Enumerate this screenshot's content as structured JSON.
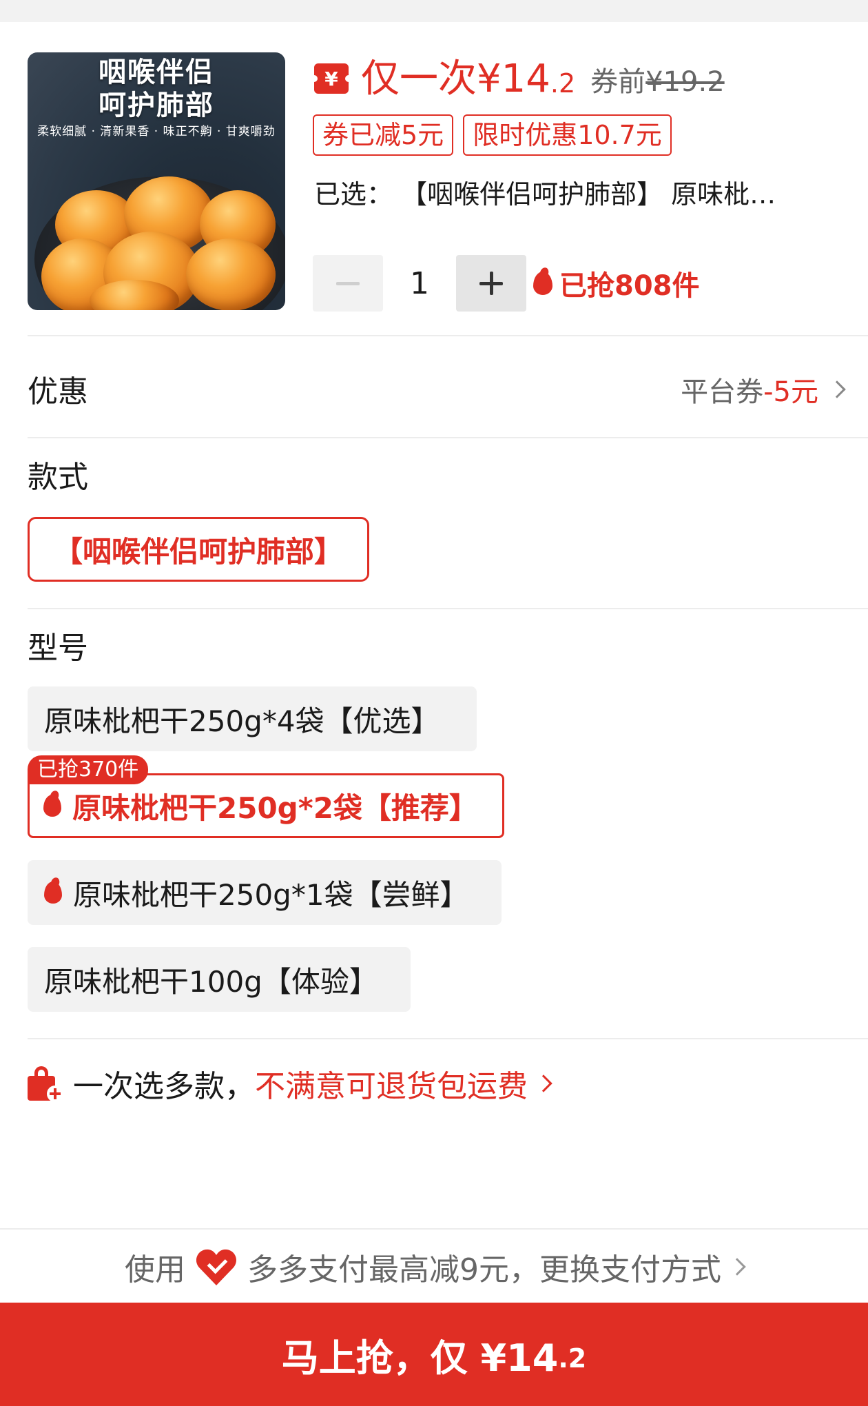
{
  "product": {
    "image_text_line1": "咽喉伴侣",
    "image_text_line2": "呵护肺部",
    "image_tagline": "柔软细腻 · 清新果香 · 味正不齁 · 甘爽嚼劲",
    "coupon_icon": "¥",
    "price_label": "仅一次¥14",
    "price_decimal": ".2",
    "price_before_label": "券前",
    "price_before": "¥19.2",
    "tags": [
      "券已减5元",
      "限时优惠10.7元"
    ],
    "selected": "已选： 【咽喉伴侣呵护肺部】 原味枇…",
    "quantity": "1",
    "sold": "已抢808件"
  },
  "discount": {
    "title": "优惠",
    "label": "平台券",
    "value": "-5元"
  },
  "style": {
    "title": "款式",
    "options": [
      "【咽喉伴侣呵护肺部】"
    ]
  },
  "model": {
    "title": "型号",
    "badge": "已抢370件",
    "options": [
      "原味枇杷干250g*4袋【优选】",
      "原味枇杷干250g*2袋【推荐】",
      "原味枇杷干250g*1袋【尝鲜】",
      "原味枇杷干100g【体验】"
    ]
  },
  "returns": {
    "text": "一次选多款，",
    "link": "不满意可退货包运费"
  },
  "payment": {
    "prefix": "使用",
    "text": "多多支付最高减9元，更换支付方式"
  },
  "buy": {
    "label": "马上抢，仅 ¥14",
    "decimal": ".2"
  },
  "colors": {
    "accent": "#e02e24",
    "chip_bg": "#f2f2f2"
  }
}
